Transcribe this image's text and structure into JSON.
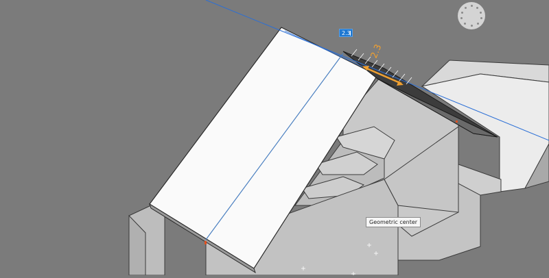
{
  "dimension_input": {
    "value": "2.3"
  },
  "dimension_label": "2.3",
  "tooltip": {
    "text": "Geometric center"
  },
  "icons": {
    "nav_wheel": "navigation-wheel-icon"
  },
  "colors": {
    "background": "#7b7b7b",
    "accent": "#1e78d2",
    "dimension": "#f0a030",
    "snap_marker": "#e05020"
  }
}
